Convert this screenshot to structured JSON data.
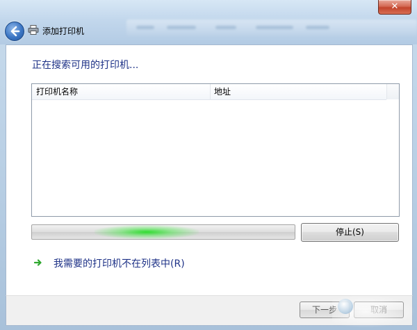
{
  "window": {
    "title": "添加打印机",
    "close_label": "✕"
  },
  "icons": {
    "back": "back-arrow-icon",
    "printer": "printer-icon",
    "link_arrow": "green-arrow-icon"
  },
  "main": {
    "heading": "正在搜索可用的打印机..."
  },
  "list": {
    "columns": [
      "打印机名称",
      "地址"
    ],
    "rows": []
  },
  "progress": {
    "indeterminate": true,
    "glow_color": "#2edc2e"
  },
  "buttons": {
    "stop": "停止(S)",
    "next": "下一步",
    "cancel": "取消"
  },
  "link": {
    "text": "我需要的打印机不在列表中(R)"
  },
  "colors": {
    "heading": "#1e3287",
    "accent_green": "#2fa82f"
  }
}
